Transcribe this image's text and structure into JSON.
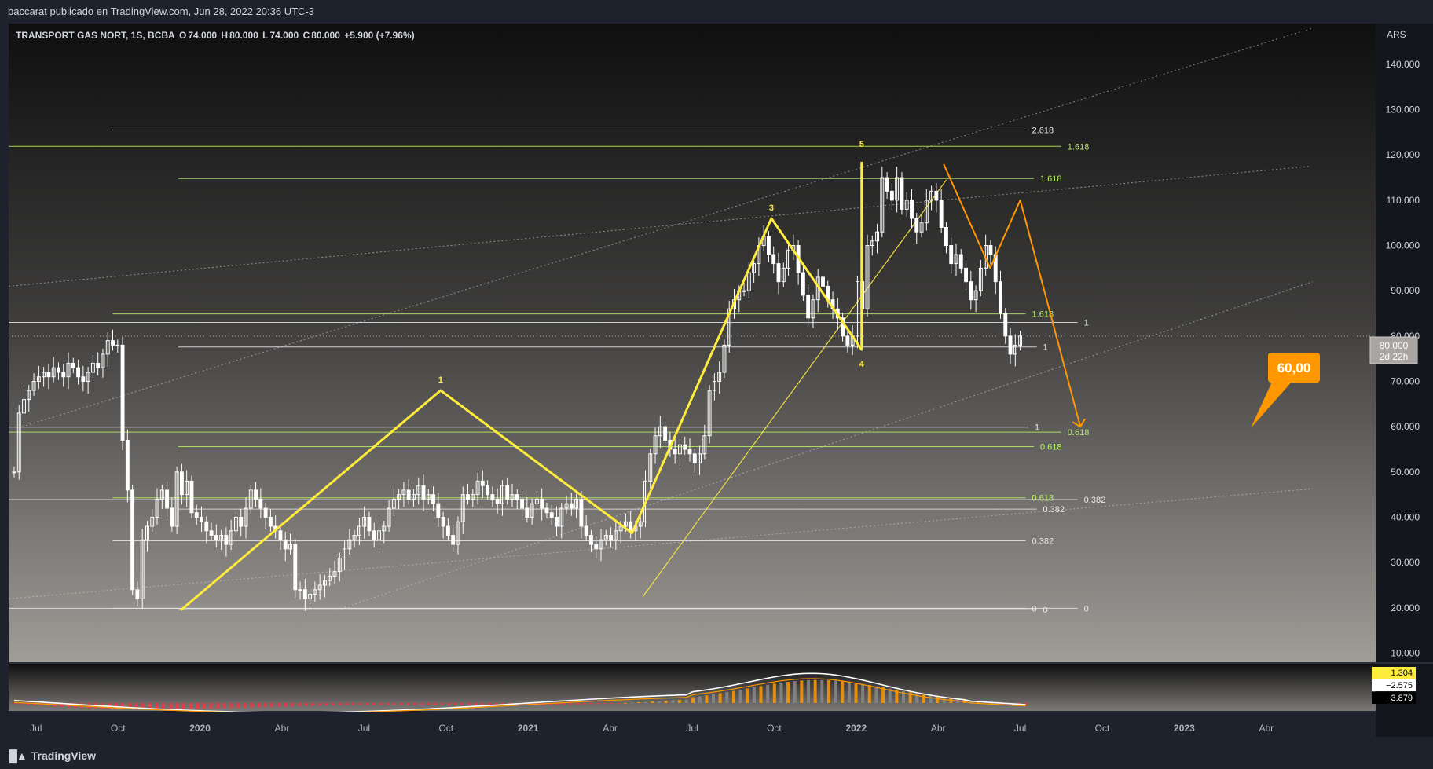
{
  "header": {
    "published": "baccarat publicado en TradingView.com, Jun 28, 2022 20:36 UTC-3"
  },
  "legend": {
    "symbol": "TRANSPORT GAS NORT, 1S, BCBA",
    "o_label": "O",
    "o_value": "74.000",
    "h_label": "H",
    "h_value": "80.000",
    "l_label": "L",
    "l_value": "74.000",
    "c_label": "C",
    "c_value": "80.000",
    "change": "+5.900 (+7.96%)"
  },
  "colors": {
    "background_top": "#0f0f0f",
    "background_bottom": "#a09c98",
    "candle": "#ffffff",
    "fib_green": "#b9f266",
    "fib_white": "#e8e8e8",
    "wave_yellow": "#ffeb3b",
    "projection_orange": "#ff9800",
    "macd_orange": "#ff9800",
    "macd_red": "#f23645",
    "macd_grey": "#888888"
  },
  "footer": {
    "brand": "TradingView"
  },
  "chart_data": {
    "type": "candlestick",
    "currency": "ARS",
    "y_ticks": [
      "140.000",
      "130.000",
      "120.000",
      "110.000",
      "100.000",
      "90.000",
      "80.000",
      "70.000",
      "60.000",
      "50.000",
      "40.000",
      "30.000",
      "20.000",
      "10.000"
    ],
    "y_tick_values": [
      140,
      130,
      120,
      110,
      100,
      90,
      80,
      70,
      60,
      50,
      40,
      30,
      20,
      10
    ],
    "ylim": [
      8,
      149
    ],
    "x_ticks": [
      "Jul",
      "Oct",
      "2020",
      "Abr",
      "Jul",
      "Oct",
      "2021",
      "Abr",
      "Jul",
      "Oct",
      "2022",
      "Abr",
      "Jul",
      "Oct",
      "2023",
      "Abr"
    ],
    "x_tick_months": [
      -6,
      -3,
      0,
      3,
      6,
      9,
      12,
      15,
      18,
      21,
      24,
      27,
      30,
      33,
      36,
      39
    ],
    "x_month_range": [
      -7.0,
      43.0
    ],
    "x_month_origin": "2020-01",
    "last_price": {
      "value": 80,
      "label": "80.000",
      "countdown": "2d 22h"
    },
    "target": {
      "label": "60,00",
      "value": 60
    },
    "waves": [
      {
        "label": "1",
        "month": 8.8,
        "price": 68
      },
      {
        "label": "3",
        "month": 20.9,
        "price": 106
      },
      {
        "label": "5",
        "month": 24.2,
        "price": 120
      },
      {
        "label": "4",
        "month": 24.2,
        "price": 77
      }
    ],
    "wave_path": [
      [
        -0.7,
        19.5
      ],
      [
        8.8,
        68
      ],
      [
        15.8,
        36.5
      ],
      [
        20.9,
        106
      ],
      [
        24.2,
        77
      ],
      [
        24.2,
        118.5
      ]
    ],
    "projection_path": [
      [
        27.2,
        118
      ],
      [
        28.9,
        95
      ],
      [
        30.0,
        110
      ],
      [
        32.2,
        60
      ]
    ],
    "fib_levels": [
      {
        "label": "2.618",
        "price": 125.5,
        "color": "white",
        "m0": -3.2,
        "m1": 30.2
      },
      {
        "label": "1.618",
        "price": 121.9,
        "color": "green",
        "m0": -7.0,
        "m1": 31.5
      },
      {
        "label": "1.618",
        "price": 114.8,
        "color": "green",
        "m0": -0.8,
        "m1": 30.5
      },
      {
        "label": "1.618",
        "price": 84.9,
        "color": "green",
        "m0": -3.2,
        "m1": 30.2
      },
      {
        "label": "1",
        "price": 83.0,
        "color": "white",
        "m0": -7.0,
        "m1": 32.1
      },
      {
        "label": "1",
        "price": 77.6,
        "color": "white",
        "m0": -0.8,
        "m1": 30.6
      },
      {
        "label": "1",
        "price": 59.9,
        "color": "white",
        "m0": -7.0,
        "m1": 30.3
      },
      {
        "label": "0.618",
        "price": 58.8,
        "color": "green",
        "m0": -7.0,
        "m1": 31.5
      },
      {
        "label": "0.618",
        "price": 55.6,
        "color": "green",
        "m0": -0.8,
        "m1": 30.5
      },
      {
        "label": "0.618",
        "price": 44.3,
        "color": "green",
        "m0": -3.2,
        "m1": 30.2
      },
      {
        "label": "0.382",
        "price": 43.9,
        "color": "white",
        "m0": -7.0,
        "m1": 32.1
      },
      {
        "label": "0.382",
        "price": 41.8,
        "color": "white",
        "m0": -0.8,
        "m1": 30.6
      },
      {
        "label": "0.382",
        "price": 34.8,
        "color": "white",
        "m0": -3.2,
        "m1": 30.2
      },
      {
        "label": "0",
        "price": 19.9,
        "color": "white",
        "m0": -3.2,
        "m1": 30.2
      },
      {
        "label": "0",
        "price": 19.6,
        "color": "white",
        "m0": -0.8,
        "m1": 30.6
      },
      {
        "label": "0",
        "price": 19.9,
        "color": "white",
        "m0": -7.0,
        "m1": 32.1
      }
    ],
    "trend_lines": [
      [
        -6.5,
        60,
        40.7,
        148
      ],
      [
        -7.0,
        91,
        40.6,
        117.5
      ],
      [
        -7.0,
        22,
        40.7,
        46.3
      ],
      [
        5.0,
        19.5,
        40.7,
        92
      ],
      [
        16.2,
        22.5,
        27.3,
        114.5
      ]
    ],
    "series_close": [
      50,
      63,
      66,
      68,
      70,
      71,
      72,
      71,
      73,
      72,
      71,
      74,
      73,
      71,
      70,
      72,
      74,
      73,
      76,
      79,
      78,
      78,
      57,
      46,
      24,
      22,
      35,
      38,
      40,
      44,
      46,
      42,
      38,
      50,
      45,
      48,
      41,
      40,
      39,
      37,
      36,
      35,
      36,
      34,
      37,
      40,
      38,
      42,
      46,
      44,
      42,
      40,
      38,
      37,
      35,
      33,
      34,
      24,
      24,
      22,
      23,
      24,
      25,
      26,
      27,
      28,
      31,
      33,
      35,
      36,
      38,
      40,
      37,
      35,
      37,
      38,
      42,
      44,
      45,
      46,
      44,
      45,
      47,
      44,
      45,
      43,
      40,
      38,
      36,
      34,
      39,
      45,
      44,
      45,
      48,
      47,
      45,
      44,
      43,
      47,
      44,
      45,
      44,
      42,
      40,
      43,
      44,
      42,
      41,
      40,
      38,
      42,
      43,
      42,
      44,
      38,
      36,
      34,
      33,
      35,
      36,
      35,
      37,
      38,
      39,
      37,
      38,
      39,
      48,
      54,
      58,
      60,
      57,
      55,
      54,
      56,
      55,
      54,
      52,
      54,
      58,
      68,
      70,
      72,
      78,
      86,
      88,
      90,
      90,
      94,
      96,
      100,
      102,
      98,
      96,
      92,
      95,
      99,
      100,
      94,
      89,
      84,
      88,
      93,
      91,
      88,
      86,
      84,
      80,
      78,
      80,
      92,
      86,
      100,
      101,
      103,
      115,
      112,
      110,
      115,
      108,
      110,
      106,
      103,
      105,
      110,
      112,
      110,
      104,
      100,
      96,
      98,
      95,
      92,
      88,
      90,
      95,
      100,
      98,
      92,
      85,
      80,
      76,
      78,
      80
    ],
    "macd": {
      "value_labels": [
        "1.304",
        "−2.575",
        "−3.879"
      ]
    }
  }
}
